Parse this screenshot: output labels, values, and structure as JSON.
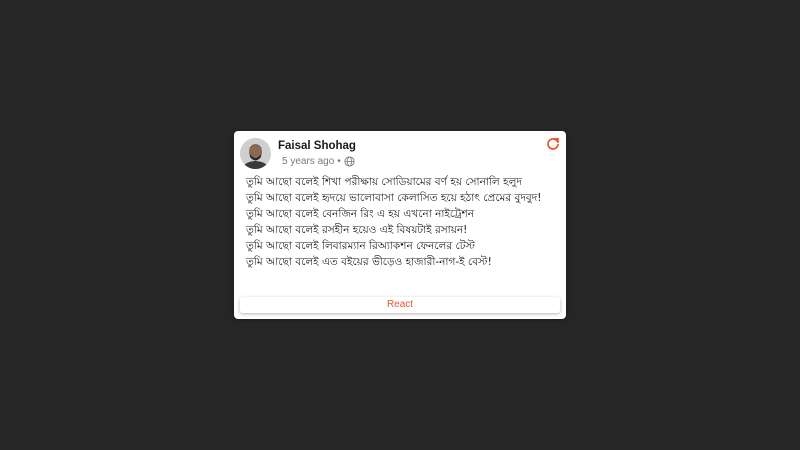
{
  "post": {
    "author": "Faisal Shohag",
    "timestamp": "5 years ago",
    "separator": "•",
    "privacy_icon": "globe-icon",
    "refresh_icon": "refresh-icon",
    "lines": [
      "তুমি আছো বলেই শিখা পরীক্ষায় সোডিয়ামের বর্ণ হয় সোনালি হলুদ",
      "তুমি আছো বলেই হৃদয়ে ভালোবাসা কেলাসিত হয়ে হঠাৎ প্রেমের বুদবুদ!",
      "তুমি আছো বলেই বেনজিন রিং এ হয় এখনো নাইট্রেশন",
      "তুমি আছো বলেই রসহীন হয়েও এই বিষয়টাই রসায়ন!",
      "তুমি আছো বলেই লিবারম্যান রিঅ্যাকশন ফেনলের টেস্ট",
      "তুমি আছো বলেই এত বইয়ের ভীড়েও হাজারী-নাগ-ই বেস্ট!"
    ],
    "react_label": "React"
  },
  "colors": {
    "page_background": "#262626",
    "card_background": "#ffffff",
    "accent": "#e8542a"
  }
}
